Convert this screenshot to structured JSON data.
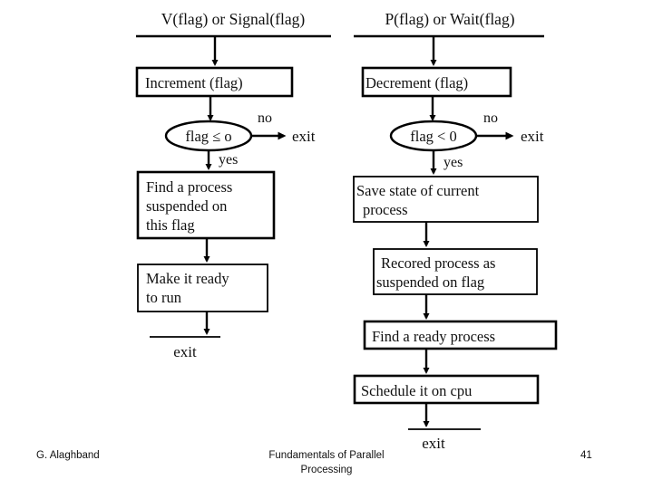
{
  "slide": {
    "page_number": "41",
    "footer": {
      "author": "G. Alaghband",
      "title_line1": "Fundamentals of Parallel",
      "title_line2": "Processing",
      "page": "41"
    }
  },
  "diagram": {
    "type": "flowchart",
    "colors": {
      "background": "#ffffff",
      "stroke": "#000000",
      "text": "#111111"
    },
    "left_flow": {
      "header": "V(flag) or Signal(flag)",
      "process_1": "Increment (flag)",
      "decision": "flag ≤ o",
      "branch_no": "no",
      "branch_yes": "yes",
      "exit_no": "exit",
      "process_2_line1": "Find a process",
      "process_2_line2": "suspended on",
      "process_2_line3": "this flag",
      "process_3_line1": "Make it ready",
      "process_3_line2": "to run",
      "exit_end": "exit"
    },
    "right_flow": {
      "header": "P(flag) or Wait(flag)",
      "process_1": "Decrement (flag)",
      "decision": "flag < 0",
      "branch_no": "no",
      "branch_yes": "yes",
      "exit_no": "exit",
      "process_2_line1": "Save state of current",
      "process_2_line2": "process",
      "process_3_line1": "Recored process as",
      "process_3_line2": "suspended on flag",
      "process_4": "Find a ready process",
      "process_5": "Schedule it on cpu",
      "exit_end": "exit"
    }
  }
}
